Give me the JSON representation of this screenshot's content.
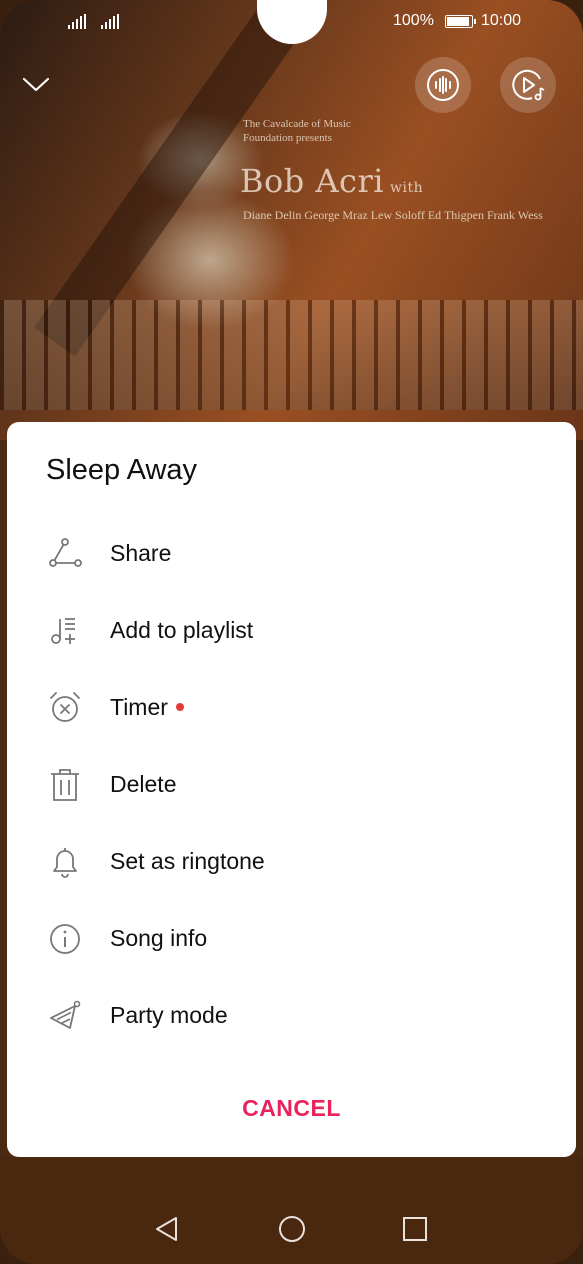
{
  "status_bar": {
    "battery_percent": "100%",
    "time": "10:00"
  },
  "album_art": {
    "presenter_text": "The Cavalcade of Music Foundation presents",
    "artist": "Bob Acri",
    "with": "with",
    "names": "Diane Delin  George Mraz  Lew Soloff  Ed Thigpen  Frank Wess"
  },
  "sheet": {
    "title": "Sleep Away",
    "items": [
      {
        "label": "Share",
        "icon": "share-icon"
      },
      {
        "label": "Add to playlist",
        "icon": "add-to-playlist-icon"
      },
      {
        "label": "Timer",
        "icon": "timer-icon",
        "badge": true
      },
      {
        "label": "Delete",
        "icon": "delete-icon"
      },
      {
        "label": "Set as ringtone",
        "icon": "bell-icon"
      },
      {
        "label": "Song info",
        "icon": "info-icon"
      },
      {
        "label": "Party mode",
        "icon": "party-mode-icon"
      }
    ],
    "cancel_label": "CANCEL"
  },
  "colors": {
    "accent": "#e8235d",
    "badge": "#e53935"
  }
}
